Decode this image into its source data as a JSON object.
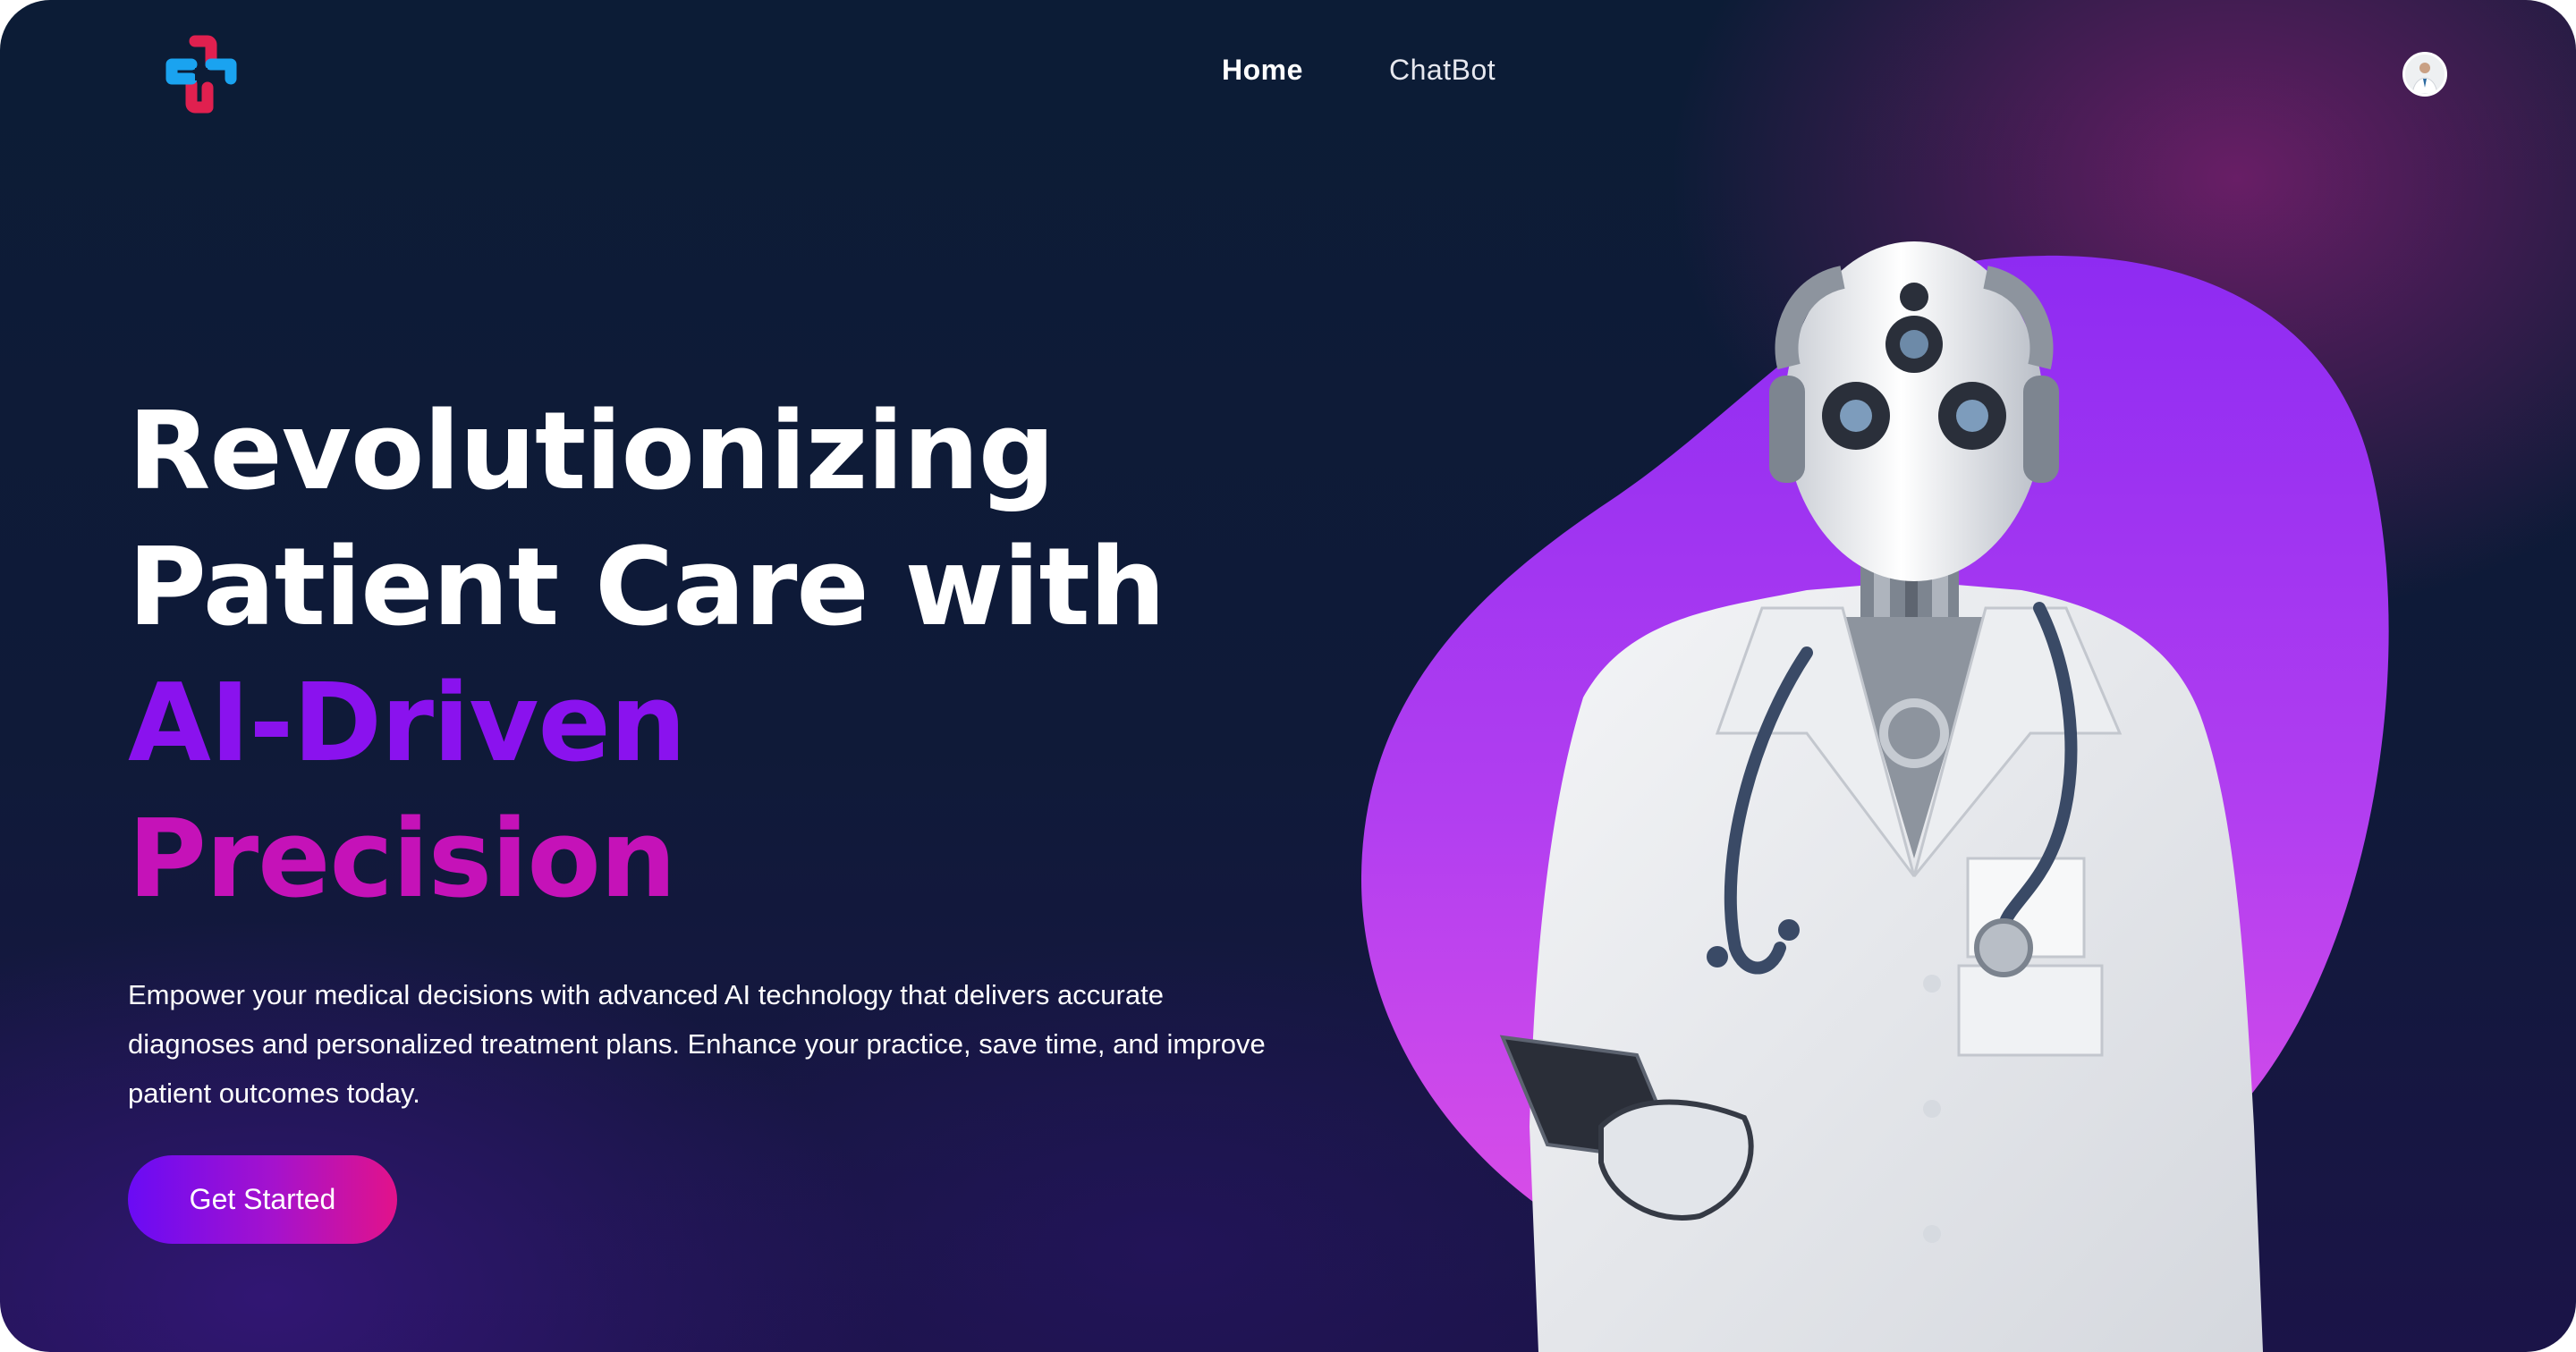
{
  "nav": {
    "home_label": "Home",
    "chatbot_label": "ChatBot"
  },
  "hero": {
    "headline_line1": "Revolutionizing",
    "headline_line2": "Patient Care with",
    "headline_accent1": "AI-Driven",
    "headline_accent2": "Precision",
    "description": "Empower your medical decisions with advanced AI technology that delivers accurate diagnoses and personalized treatment plans. Enhance your practice, save time, and improve patient outcomes today.",
    "cta_label": "Get Started"
  },
  "colors": {
    "background": "#0c1c36",
    "accent_purple": "#8a12ee",
    "accent_magenta": "#c512b8",
    "blob": "#a93cf0",
    "logo_blue": "#1aa3f0",
    "logo_red": "#e0204f"
  },
  "icons": {
    "logo": "medical-cross-logo",
    "avatar": "doctor-avatar"
  }
}
